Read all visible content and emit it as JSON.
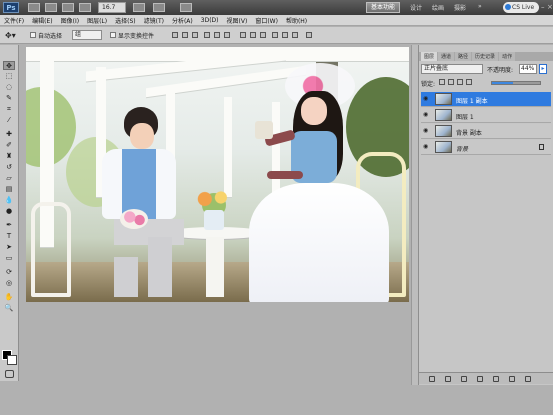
{
  "app": {
    "logo": "Ps",
    "zoom": "16.7",
    "workspace_active": "基本功能",
    "workspace_items": [
      "设计",
      "绘画",
      "摄影"
    ],
    "cs_live": "CS Live"
  },
  "menu": [
    "文件(F)",
    "编辑(E)",
    "图像(I)",
    "图层(L)",
    "选择(S)",
    "滤镜(T)",
    "分析(A)",
    "3D(D)",
    "视图(V)",
    "窗口(W)",
    "帮助(H)"
  ],
  "options": {
    "auto_select_label": "自动选择",
    "auto_select_value": "组",
    "show_transform_label": "显示变换控件"
  },
  "layers_panel": {
    "tabs": [
      "图层",
      "通道",
      "路径",
      "历史记录",
      "动作"
    ],
    "blend_mode": "正片叠底",
    "opacity_label": "不透明度:",
    "opacity_value": "44%",
    "lock_label": "锁定:",
    "fill_percent": 44,
    "layers": [
      {
        "name": "图层 1 副本",
        "selected": true
      },
      {
        "name": "图层 1",
        "selected": false
      },
      {
        "name": "背景 副本",
        "selected": false
      },
      {
        "name": "背景",
        "selected": false,
        "italic": true,
        "locked": true
      }
    ]
  },
  "colors": {
    "accent": "#2f7be0",
    "foreground": "#000000",
    "background": "#ffffff"
  }
}
